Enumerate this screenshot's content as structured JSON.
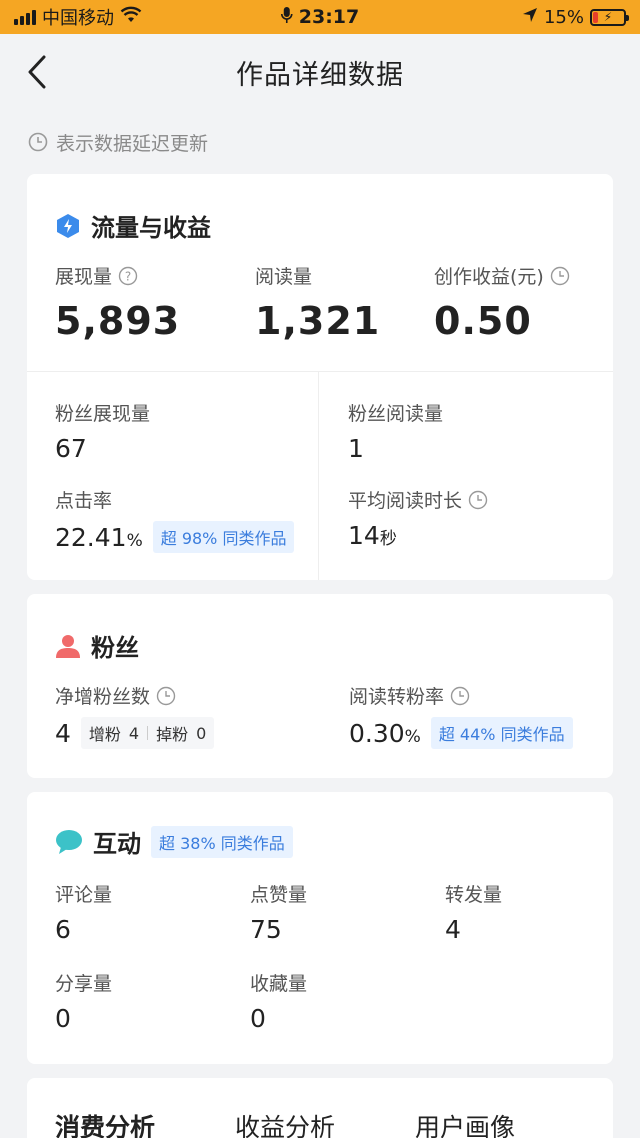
{
  "status_bar": {
    "carrier": "中国移动",
    "time": "23:17",
    "battery_percent": "15%",
    "battery_level": 0.15,
    "icons": [
      "signal-icon",
      "wifi-icon",
      "mic-icon",
      "location-icon",
      "battery-icon"
    ]
  },
  "nav": {
    "title": "作品详细数据"
  },
  "notice": "表示数据延迟更新",
  "traffic": {
    "title": "流量与收益",
    "impressions": {
      "label": "展现量",
      "value": "5,893"
    },
    "reads": {
      "label": "阅读量",
      "value": "1,321"
    },
    "income": {
      "label": "创作收益(元)",
      "value": "0.50"
    },
    "fan_impressions": {
      "label": "粉丝展现量",
      "value": "67"
    },
    "fan_reads": {
      "label": "粉丝阅读量",
      "value": "1"
    },
    "ctr": {
      "label": "点击率",
      "value": "22.41",
      "unit": "%",
      "badge": "超 98% 同类作品"
    },
    "avg_read_time": {
      "label": "平均阅读时长",
      "value": "14",
      "unit": "秒"
    }
  },
  "fans": {
    "title": "粉丝",
    "net_fans": {
      "label": "净增粉丝数",
      "value": "4",
      "gain_label": "增粉",
      "gain": "4",
      "loss_label": "掉粉",
      "loss": "0"
    },
    "conversion": {
      "label": "阅读转粉率",
      "value": "0.30",
      "unit": "%",
      "badge": "超 44% 同类作品"
    }
  },
  "interaction": {
    "title": "互动",
    "badge": "超 38% 同类作品",
    "comments": {
      "label": "评论量",
      "value": "6"
    },
    "likes": {
      "label": "点赞量",
      "value": "75"
    },
    "forwards": {
      "label": "转发量",
      "value": "4"
    },
    "shares": {
      "label": "分享量",
      "value": "0"
    },
    "favorites": {
      "label": "收藏量",
      "value": "0"
    }
  },
  "tabs": [
    {
      "label": "消费分析"
    },
    {
      "label": "收益分析"
    },
    {
      "label": "用户画像"
    }
  ],
  "colors": {
    "status_bar": "#f5a623",
    "accent_blue": "#3b7ddd",
    "badge_bg": "#e8f2ff",
    "fans_icon": "#f06a6a",
    "interact_icon": "#3cc2c8"
  }
}
